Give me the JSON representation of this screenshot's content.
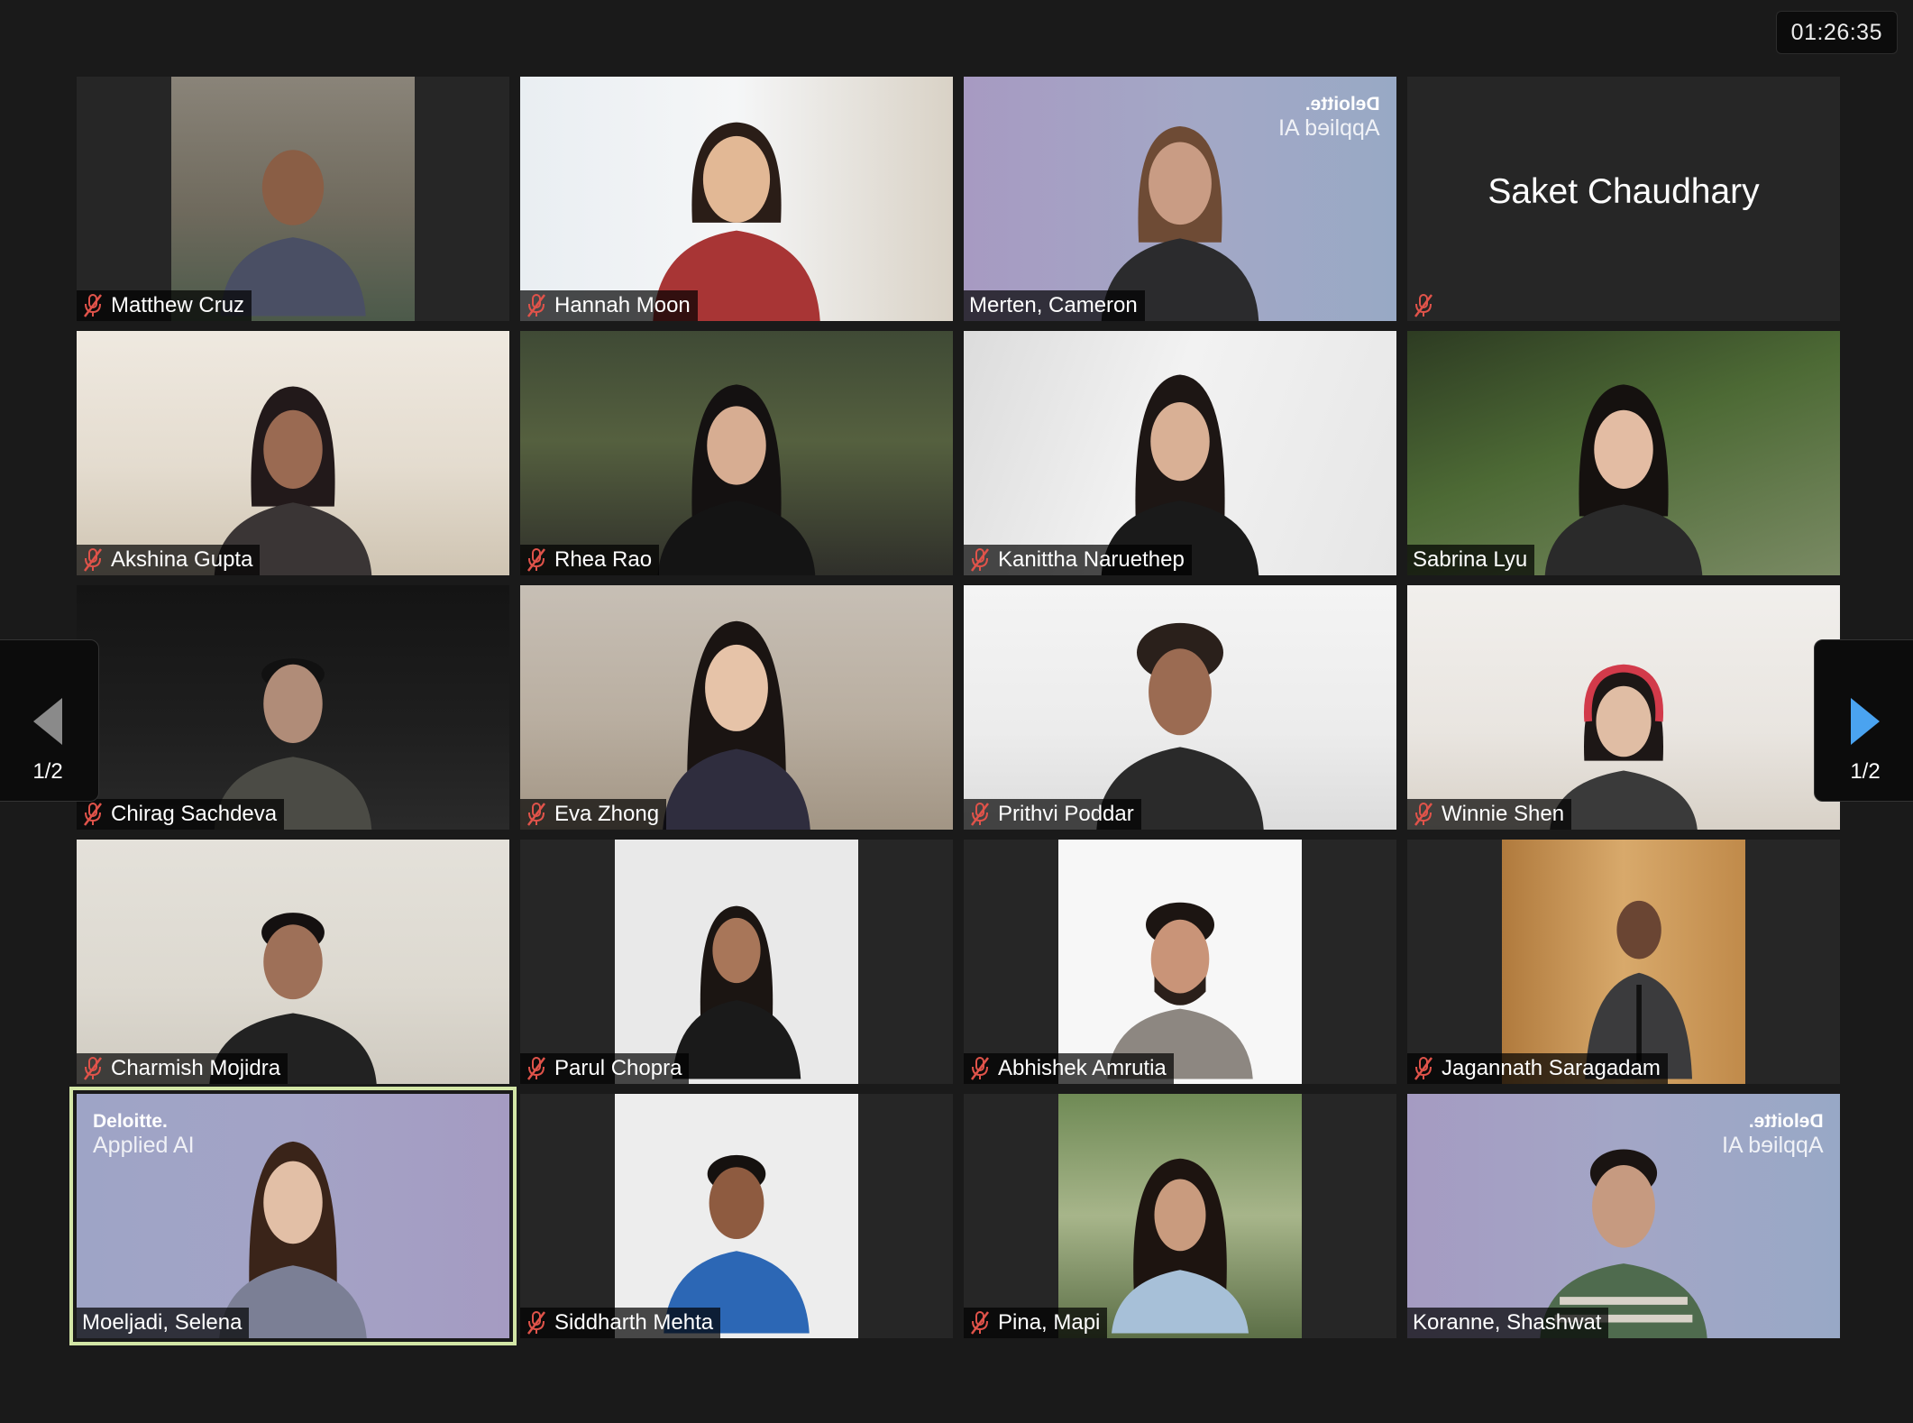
{
  "timer": "01:26:35",
  "pager": {
    "left": "1/2",
    "right": "1/2"
  },
  "colors": {
    "background": "#1a1a1a",
    "tile": "#262626",
    "active_speaker_border": "#d3e6a6",
    "muted_mic": "#e0534a",
    "nav_arrow_left": "#8a8a8a",
    "nav_arrow_right": "#4aa3f0"
  },
  "participants": [
    {
      "name": "Matthew Cruz",
      "muted": true,
      "video": true
    },
    {
      "name": "Hannah Moon",
      "muted": true,
      "video": true
    },
    {
      "name": "Merten, Cameron",
      "muted": false,
      "video": true,
      "background_logo": {
        "brand": "Deloitte.",
        "sub": "Applied AI",
        "mirrored": true
      }
    },
    {
      "name": "Saket Chaudhary",
      "muted": true,
      "video": false
    },
    {
      "name": "Akshina Gupta",
      "muted": true,
      "video": true
    },
    {
      "name": "Rhea Rao",
      "muted": true,
      "video": true
    },
    {
      "name": "Kanittha Naruethep",
      "muted": true,
      "video": true
    },
    {
      "name": "Sabrina Lyu",
      "muted": false,
      "video": true
    },
    {
      "name": "Chirag Sachdeva",
      "muted": true,
      "video": true
    },
    {
      "name": "Eva Zhong",
      "muted": true,
      "video": true
    },
    {
      "name": "Prithvi Poddar",
      "muted": true,
      "video": true
    },
    {
      "name": "Winnie Shen",
      "muted": true,
      "video": true
    },
    {
      "name": "Charmish Mojidra",
      "muted": true,
      "video": true
    },
    {
      "name": "Parul Chopra",
      "muted": true,
      "video": true
    },
    {
      "name": "Abhishek Amrutia",
      "muted": true,
      "video": true
    },
    {
      "name": "Jagannath Saragadam",
      "muted": true,
      "video": true
    },
    {
      "name": "Moeljadi, Selena",
      "muted": false,
      "video": true,
      "active_speaker": true,
      "background_logo": {
        "brand": "Deloitte.",
        "sub": "Applied AI",
        "mirrored": false
      }
    },
    {
      "name": "Siddharth Mehta",
      "muted": true,
      "video": true
    },
    {
      "name": "Pina, Mapi",
      "muted": true,
      "video": true
    },
    {
      "name": "Koranne, Shashwat",
      "muted": false,
      "video": true,
      "background_logo": {
        "brand": "Deloitte.",
        "sub": "Applied AI",
        "mirrored": true
      }
    }
  ]
}
